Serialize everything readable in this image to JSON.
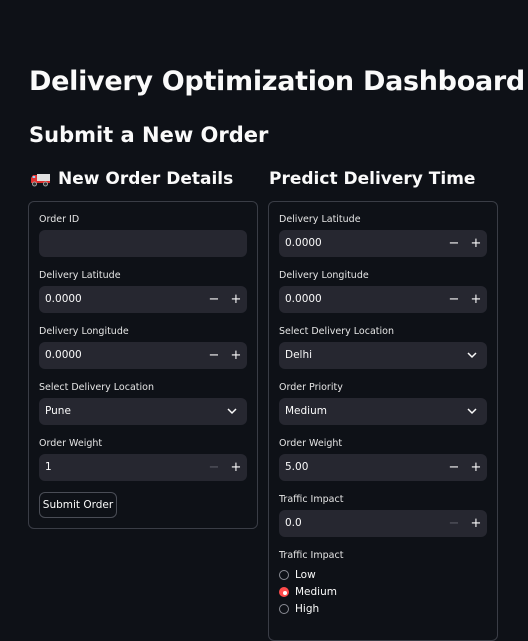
{
  "header": {
    "title": "Delivery Optimization Dashboard",
    "subtitle": "Submit a New Order"
  },
  "order_form": {
    "heading": "New Order Details",
    "heading_icon": "truck-icon",
    "order_id_label": "Order ID",
    "order_id_value": "",
    "lat_label": "Delivery Latitude",
    "lat_value": "0.0000",
    "lon_label": "Delivery Longitude",
    "lon_value": "0.0000",
    "location_label": "Select Delivery Location",
    "location_value": "Pune",
    "weight_label": "Order Weight",
    "weight_value": "1",
    "submit_label": "Submit Order"
  },
  "predict_form": {
    "heading": "Predict Delivery Time",
    "lat_label": "Delivery Latitude",
    "lat_value": "0.0000",
    "lon_label": "Delivery Longitude",
    "lon_value": "0.0000",
    "location_label": "Select Delivery Location",
    "location_value": "Delhi",
    "priority_label": "Order Priority",
    "priority_value": "Medium",
    "weight_label": "Order Weight",
    "weight_value": "5.00",
    "traffic_label": "Traffic Impact",
    "traffic_value": "0.0",
    "traffic_radio_label": "Traffic Impact",
    "traffic_options": [
      "Low",
      "Medium",
      "High"
    ],
    "traffic_selected": "Medium"
  },
  "stepper": {
    "minus": "−",
    "plus": "+"
  },
  "colors": {
    "background": "#0e1117",
    "input": "#262730",
    "accent": "#ff4b4b",
    "border": "#3a3d46"
  }
}
